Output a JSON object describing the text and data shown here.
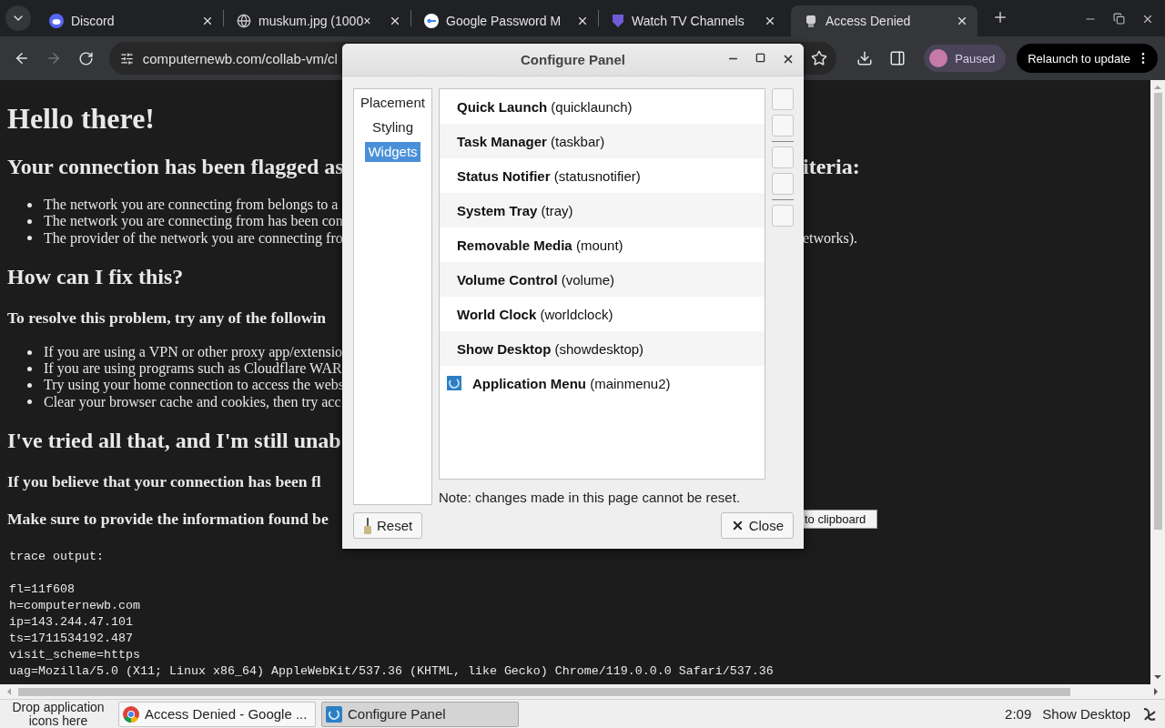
{
  "browser": {
    "tabs": [
      {
        "title": "Discord",
        "selected": false
      },
      {
        "title": "muskum.jpg (1000×",
        "selected": false
      },
      {
        "title": "Google Password M",
        "selected": false
      },
      {
        "title": "Watch TV Channels",
        "selected": false
      },
      {
        "title": "Access Denied",
        "selected": true
      }
    ],
    "address": "computernewb.com/collab-vm/cl",
    "forward_disabled": true,
    "profile": "Paused",
    "update_button": "Relaunch to update"
  },
  "page": {
    "blocks": [
      {
        "kind": "heading1",
        "text": "Hello there!"
      },
      {
        "kind": "heading2",
        "text": "Your connection has been flagged as",
        "right": "iteria:"
      },
      {
        "kind": "list",
        "items": [
          {
            "text": "The network you are connecting from belongs to a"
          },
          {
            "text": "The network you are connecting from has been con"
          },
          {
            "text": "The provider of the network you are connecting fro",
            "right": "etworks)."
          }
        ]
      },
      {
        "kind": "heading2",
        "text": "How can I fix this?"
      },
      {
        "kind": "heading3",
        "text": "To resolve this problem, try any of the followin"
      },
      {
        "kind": "list",
        "items": [
          {
            "text": "If you are using a VPN or other proxy app/extensio"
          },
          {
            "text": "If you are using programs such as Cloudflare WAR"
          },
          {
            "text": "Try using your home connection to access the webs"
          },
          {
            "text": "Clear your browser cache and cookies, then try acc"
          }
        ]
      },
      {
        "kind": "heading2",
        "text": "I've tried all that, and I'm still unab"
      },
      {
        "kind": "heading3",
        "text": "If you believe that your connection has been fl"
      },
      {
        "kind": "heading3",
        "text": "Make sure to provide the information found be",
        "right_button": "to clipboard"
      }
    ],
    "trace": {
      "title": "trace output:",
      "lines": [
        "fl=11f608",
        "h=computernewb.com",
        "ip=143.244.47.101",
        "ts=1711534192.487",
        "visit_scheme=https",
        "uag=Mozilla/5.0 (X11; Linux x86_64) AppleWebKit/537.36 (KHTML, like Gecko) Chrome/119.0.0.0 Safari/537.36"
      ]
    }
  },
  "dialog": {
    "title": "Configure Panel",
    "sections": [
      {
        "label": "Placement",
        "selected": false
      },
      {
        "label": "Styling",
        "selected": false
      },
      {
        "label": "Widgets",
        "selected": true
      }
    ],
    "widgets": [
      {
        "label": "**Quick Launch** (quicklaunch)",
        "kind": "plain"
      },
      {
        "label": "**Task Manager** (taskbar)",
        "kind": "plain"
      },
      {
        "label": "**Status Notifier** (statusnotifier)",
        "kind": "plain"
      },
      {
        "label": "**System Tray** (tray)",
        "kind": "plain"
      },
      {
        "label": "**Removable Media** (mount)",
        "kind": "plain"
      },
      {
        "label": "**Volume Control** (volume)",
        "kind": "plain"
      },
      {
        "label": "**World Clock** (worldclock)",
        "kind": "plain"
      },
      {
        "label": "**Show Desktop** (showdesktop)",
        "kind": "plain"
      },
      {
        "label": "**Application Menu** (mainmenu2)",
        "kind": "icon"
      }
    ],
    "note": "Note: changes made in this page cannot be reset.",
    "reset_button": "Reset",
    "close_button": "Close"
  },
  "taskbar": {
    "drop_hint": "Drop application icons here",
    "tasks": [
      {
        "title": "Access Denied - Google ...",
        "selected": false
      },
      {
        "title": "Configure Panel",
        "selected": true
      }
    ],
    "clock": "2:09",
    "show_desktop": "Show Desktop"
  }
}
